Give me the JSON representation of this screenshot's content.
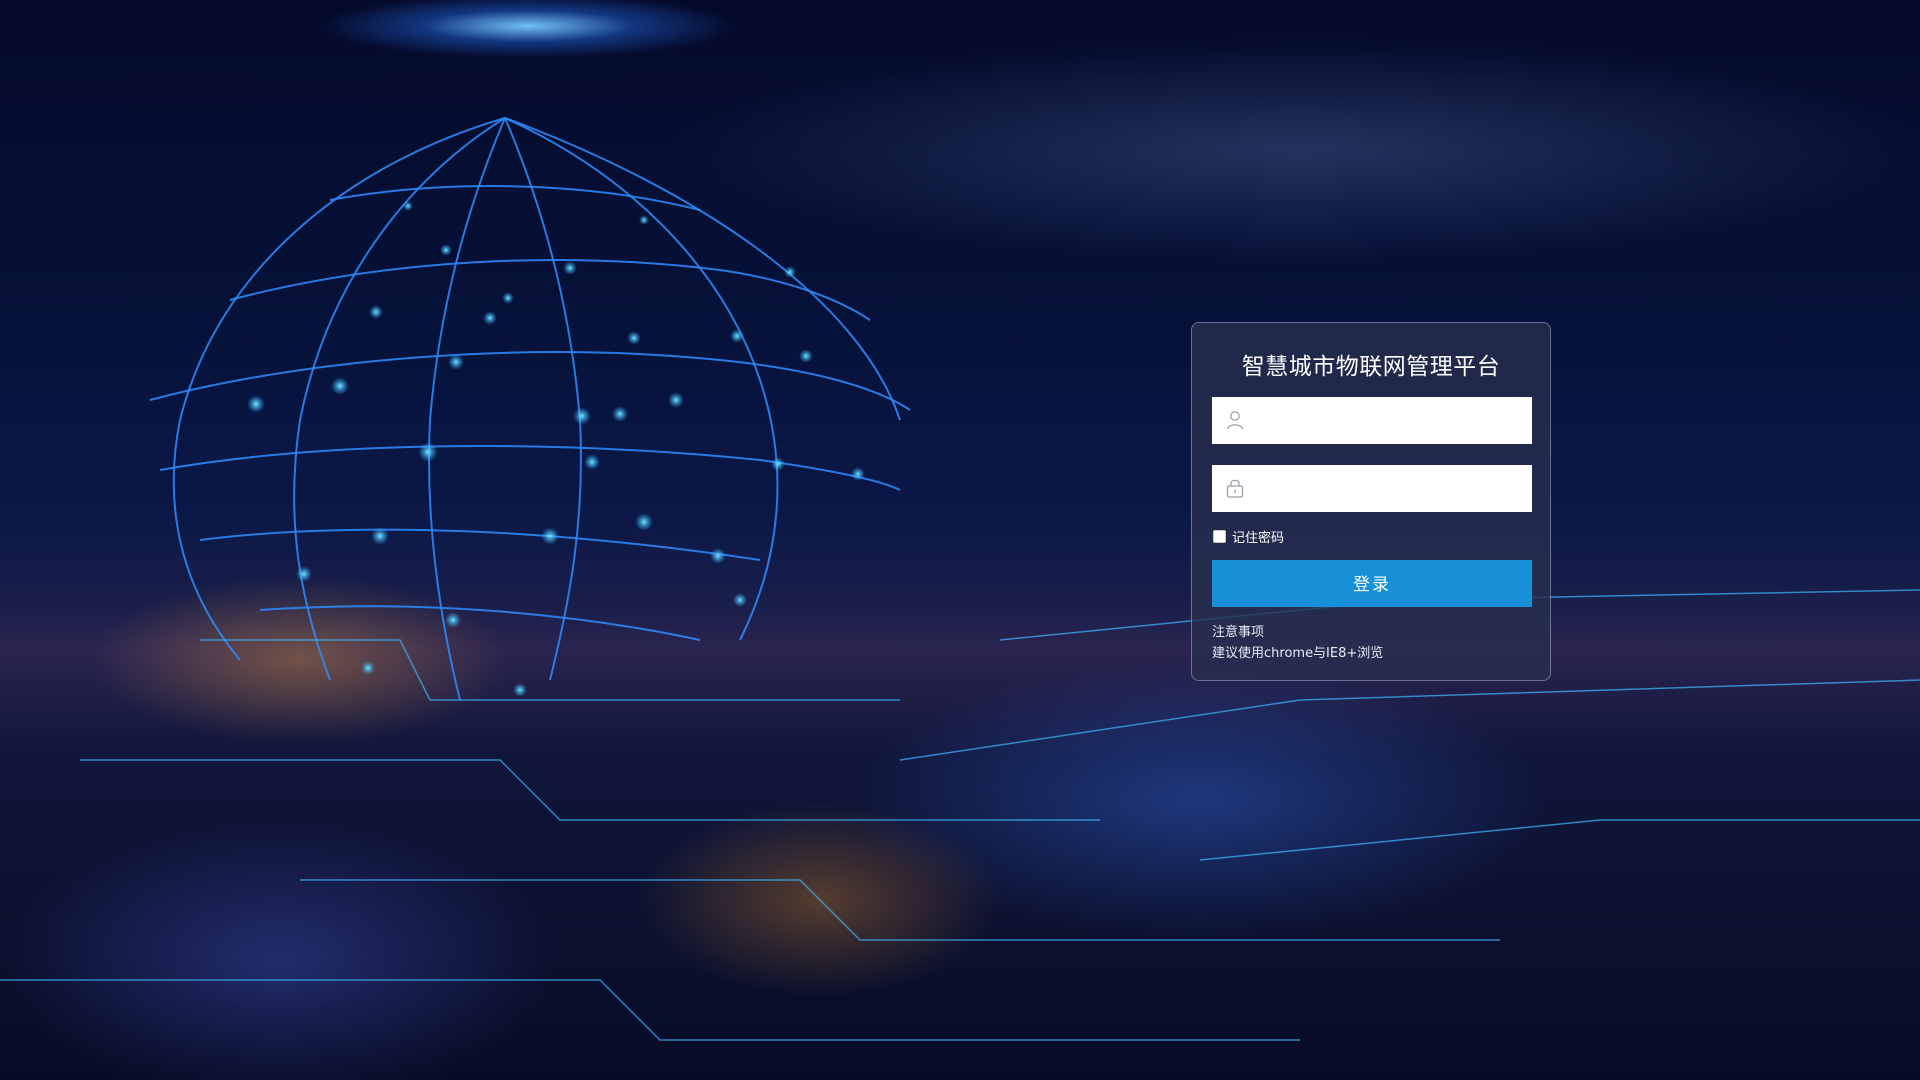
{
  "login": {
    "title": "智慧城市物联网管理平台",
    "username_placeholder": "",
    "password_placeholder": "",
    "remember_label": "记住密码",
    "remember_checked": false,
    "submit_label": "登录",
    "notice_title": "注意事项",
    "notice_text": "建议使用chrome与IE8+浏览"
  },
  "icons": {
    "username": "user-icon",
    "password": "lock-icon"
  },
  "colors": {
    "panel_bg": "#28304e",
    "button": "#1790d8",
    "accent_glow": "#3fd0ff"
  }
}
